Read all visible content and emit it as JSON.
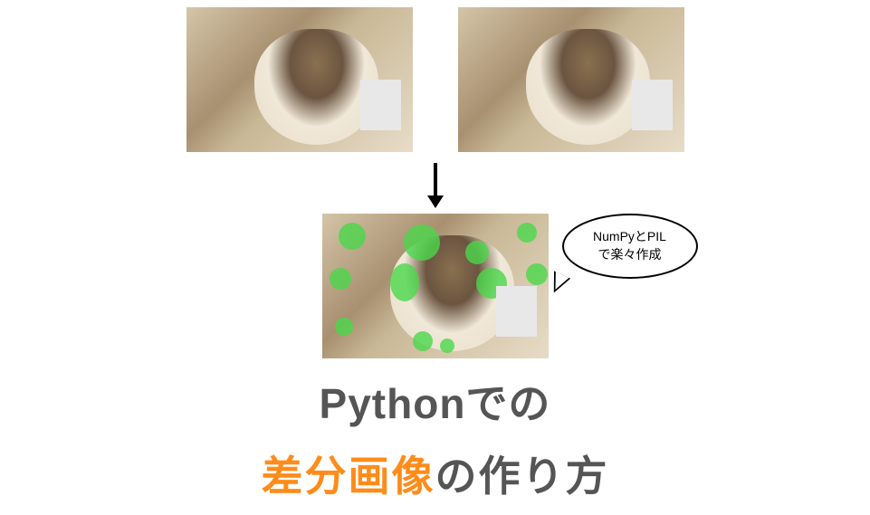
{
  "speech": {
    "line1": "NumPyとPIL",
    "line2": "で楽々作成"
  },
  "title": {
    "line1": "Pythonでの",
    "line2_highlight": "差分画像",
    "line2_rest": "の作り方"
  }
}
